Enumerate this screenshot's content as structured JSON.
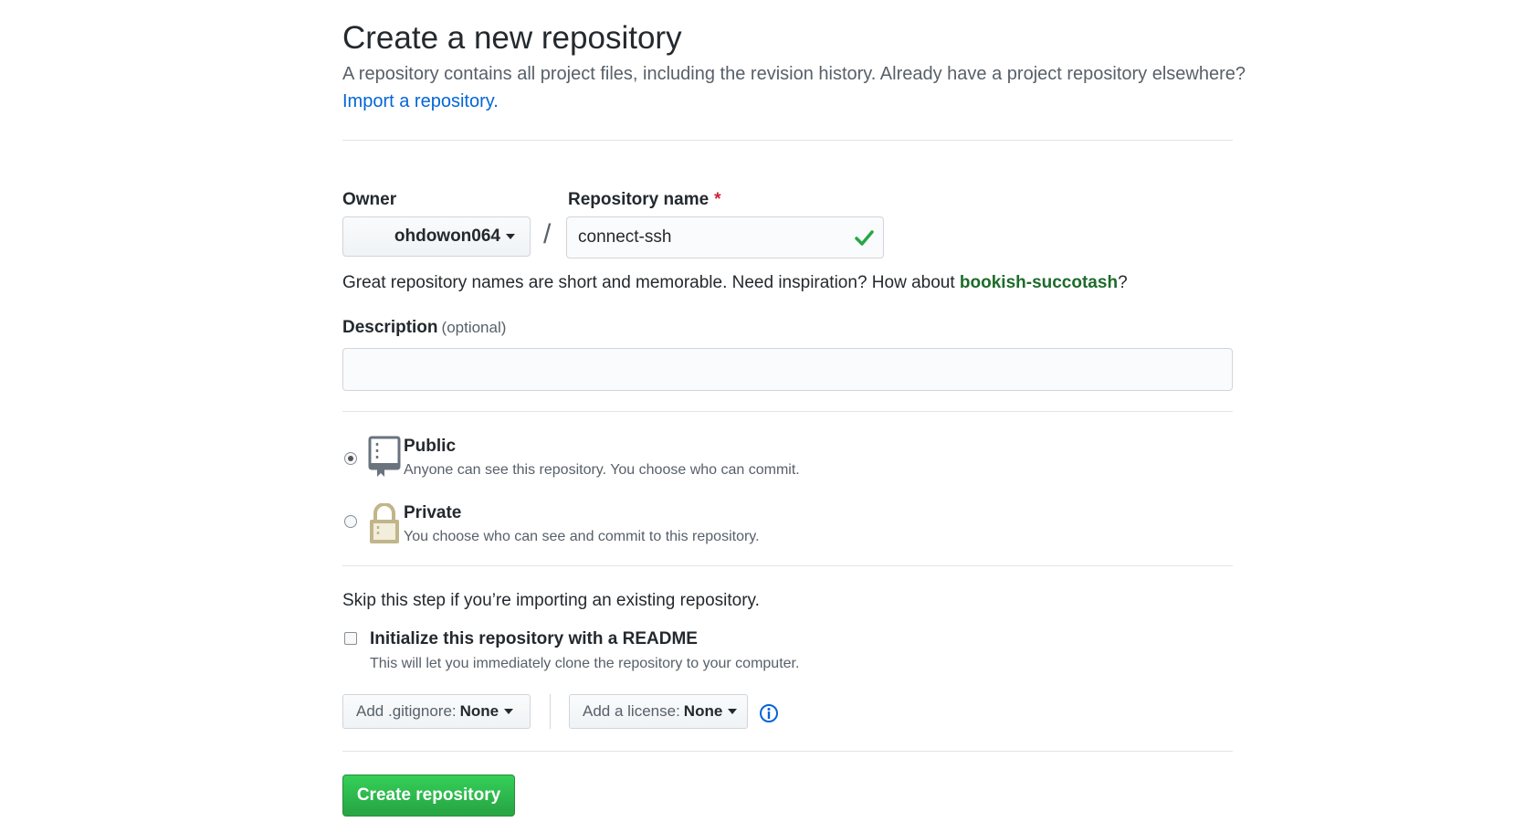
{
  "header": {
    "title": "Create a new repository",
    "description": "A repository contains all project files, including the revision history. Already have a project repository elsewhere?",
    "import_link": "Import a repository."
  },
  "owner": {
    "label": "Owner",
    "value": "ohdowon064"
  },
  "repo_name": {
    "label": "Repository name",
    "required_marker": "*",
    "value": "connect-ssh",
    "valid": true
  },
  "name_hint": {
    "prefix": "Great repository names are short and memorable. Need inspiration? How about ",
    "suggestion": "bookish-succotash",
    "suffix": "?"
  },
  "description": {
    "label": "Description",
    "optional": "(optional)",
    "value": ""
  },
  "visibility": {
    "selected": "public",
    "options": [
      {
        "id": "public",
        "title": "Public",
        "desc": "Anyone can see this repository. You choose who can commit.",
        "icon": "repo-icon"
      },
      {
        "id": "private",
        "title": "Private",
        "desc": "You choose who can see and commit to this repository.",
        "icon": "lock-icon"
      }
    ]
  },
  "init": {
    "skip_text": "Skip this step if you’re importing an existing repository.",
    "readme_label": "Initialize this repository with a README",
    "readme_desc": "This will let you immediately clone the repository to your computer.",
    "readme_checked": false
  },
  "gitignore": {
    "label": "Add .gitignore:",
    "value": "None"
  },
  "license": {
    "label": "Add a license:",
    "value": "None"
  },
  "submit": {
    "label": "Create repository"
  },
  "colors": {
    "link": "#0366d6",
    "success": "#28a745",
    "required": "#cb2431",
    "lock_icon": "#c1b58a"
  }
}
